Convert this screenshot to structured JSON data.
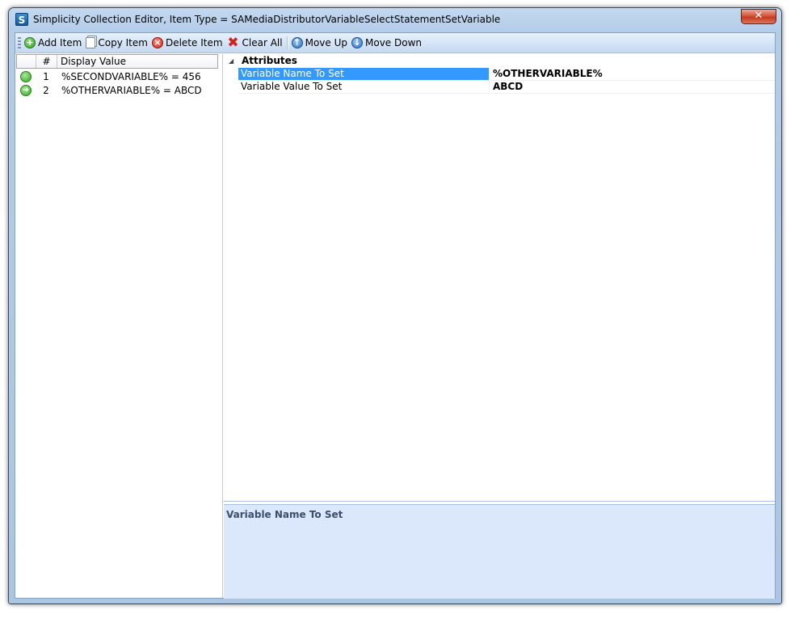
{
  "window": {
    "title": "Simplicity Collection Editor, Item Type = SAMediaDistributorVariableSelectStatementSetVariable",
    "app_icon_letter": "S",
    "close_glyph": "✕"
  },
  "toolbar": {
    "add_label": "Add Item",
    "copy_label": "Copy Item",
    "delete_label": "Delete Item",
    "clear_label": "Clear All",
    "move_up_label": "Move Up",
    "move_down_label": "Move Down"
  },
  "list": {
    "columns": [
      "",
      "#",
      "Display Value"
    ],
    "rows": [
      {
        "num": "1",
        "value": "%SECONDVARIABLE% = 456",
        "status_icon": "green-circle-icon"
      },
      {
        "num": "2",
        "value": "%OTHERVARIABLE% = ABCD",
        "status_icon": "green-arrow-circle-icon",
        "selected": true
      }
    ]
  },
  "property_grid": {
    "category": "Attributes",
    "properties": [
      {
        "name": "Variable Name To Set",
        "value": "%OTHERVARIABLE%",
        "selected": true
      },
      {
        "name": "Variable Value To Set",
        "value": "ABCD"
      }
    ]
  },
  "help_panel": {
    "title": "Variable Name To Set"
  },
  "colors": {
    "selection": "#3399ff",
    "help_bg": "#dbe8fb",
    "frame": "#aac6e4"
  }
}
